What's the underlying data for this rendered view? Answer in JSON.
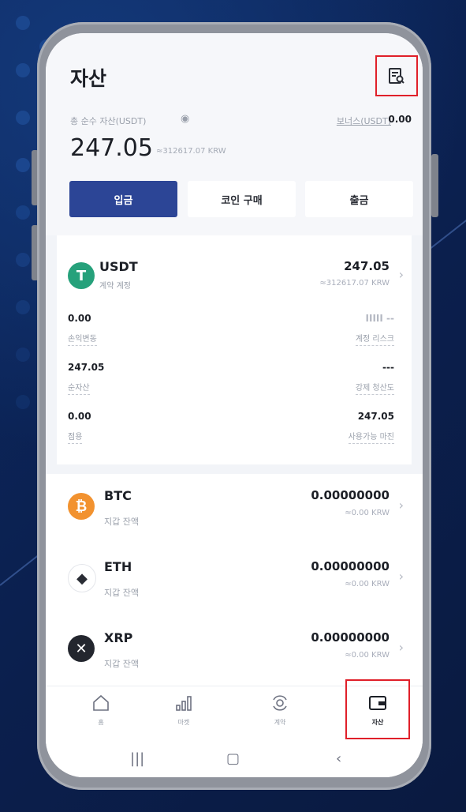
{
  "header": {
    "title": "자산",
    "net_asset_label": "총 순수 자산(USDT)",
    "net_asset_value": "247.05",
    "net_asset_krw": "≈312617.07 KRW",
    "bonus_label": "보너스(USDT)",
    "bonus_value": "0.00"
  },
  "actions": {
    "deposit": "입금",
    "buy": "코인 구매",
    "withdraw": "출금"
  },
  "usdt": {
    "name": "USDT",
    "sub": "계약 계정",
    "value": "247.05",
    "krw": "≈312617.07 KRW",
    "stats_left": [
      {
        "value": "0.00",
        "label": "손익변동"
      },
      {
        "value": "247.05",
        "label": "순자산"
      },
      {
        "value": "0.00",
        "label": "점용"
      }
    ],
    "stats_right": [
      {
        "value": "IIIII --",
        "label": "계정 리스크"
      },
      {
        "value": "---",
        "label": "강제 청산도"
      },
      {
        "value": "247.05",
        "label": "사용가능 마진"
      }
    ]
  },
  "coins": [
    {
      "name": "BTC",
      "sub": "지갑 잔액",
      "value": "0.00000000",
      "krw": "≈0.00 KRW",
      "color": "#f2922f"
    },
    {
      "name": "ETH",
      "sub": "지갑 잔액",
      "value": "0.00000000",
      "krw": "≈0.00 KRW",
      "color": "#ffffff"
    },
    {
      "name": "XRP",
      "sub": "지갑 잔액",
      "value": "0.00000000",
      "krw": "≈0.00 KRW",
      "color": "#23262e"
    }
  ],
  "nav": [
    {
      "label": "홈",
      "icon": "home-icon"
    },
    {
      "label": "마켓",
      "icon": "market-icon"
    },
    {
      "label": "계약",
      "icon": "contract-icon"
    },
    {
      "label": "자산",
      "icon": "wallet-icon"
    }
  ],
  "colors": {
    "accent": "#2c4596",
    "highlight": "#e0202a",
    "usdt_green": "#26a17b"
  }
}
